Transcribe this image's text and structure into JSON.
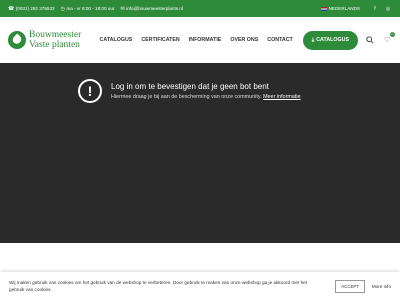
{
  "topbar": {
    "phone": "(0031) 252 375533",
    "hours": "ma - vr 8:00 - 18:00 uur",
    "email": "info@bouwmeesterplants.nl",
    "language": "NEDERLANDS"
  },
  "logo": {
    "line1": "Bouwmeester",
    "line2": "Vaste planten"
  },
  "nav": [
    {
      "label": "CATALOGUS"
    },
    {
      "label": "CERTIFICATEN"
    },
    {
      "label": "INFORMATIE"
    },
    {
      "label": "OVER ONS"
    },
    {
      "label": "CONTACT"
    }
  ],
  "cta": {
    "label": "CATALOGUS"
  },
  "cart": {
    "count": "0"
  },
  "notice": {
    "title": "Log in om te bevestigen dat je geen bot bent",
    "text": "Hiermee draag je bij aan de bescherming van onze community.",
    "link": "Meer informatie"
  },
  "cookie": {
    "text": "Wij maken gebruik van cookies om het gebruik van de webshop te verbeteren. Door gebruik te maken van onze webshop ga je akkoord met het gebruik van cookies.",
    "accept": "ACCEPT",
    "more": "More info"
  },
  "colors": {
    "brand": "#2e8b3a",
    "overlay": "#2a2a2a"
  }
}
